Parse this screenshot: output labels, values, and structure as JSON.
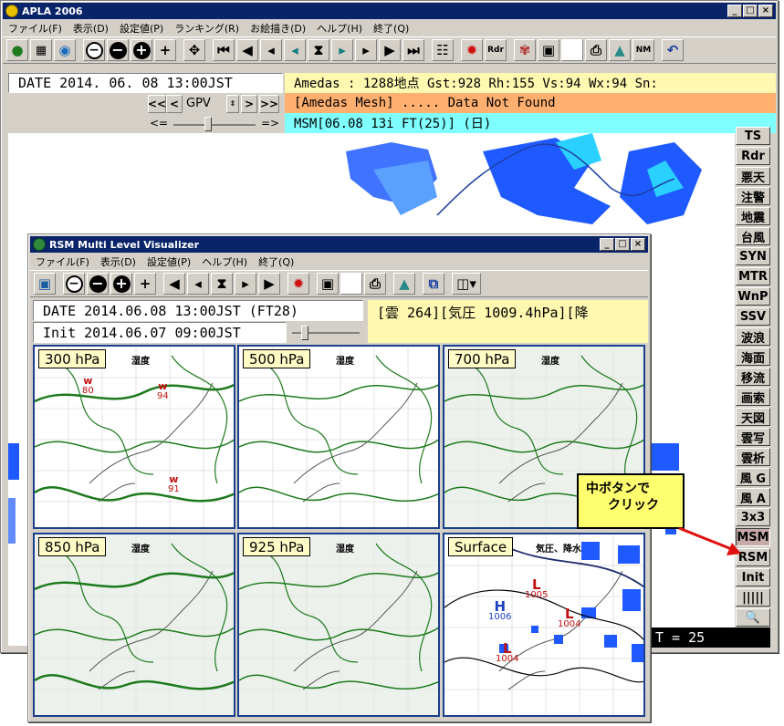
{
  "main_window": {
    "title": "APLA 2006",
    "menu": [
      "ファイル(F)",
      "表示(D)",
      "設定値(P)",
      "ランキング(R)",
      "お絵描き(D)",
      "ヘルプ(H)",
      "終了(Q)"
    ],
    "date": "DATE 2014. 06. 08  13:00JST",
    "gpv_label": "GPV",
    "nav": {
      "prev2": "<<",
      "prev": "<",
      "next": ">",
      "next2": ">>",
      "slider_left": "<=",
      "slider_right": "=>"
    },
    "amedas_line": "Amedas : 1288地点  Gst:928 Rh:155 Vs:94 Wx:94 Sn:",
    "mesh_line": "[Amedas Mesh] ..... Data Not Found",
    "msm_line": "MSM[06.08 13i FT(25)] (日)",
    "bottom_status": "T = 25",
    "side_buttons": [
      "TS",
      "Rdr",
      "悪天",
      "注警",
      "地震",
      "台風",
      "SYN",
      "MTR",
      "WnP",
      "SSV",
      "波浪",
      "海面",
      "移流",
      "画索",
      "天図",
      "雲写",
      "雲析",
      "風 G",
      "風 A",
      "3x3",
      "MSM",
      "RSM",
      "Init",
      "|||||",
      "🔍"
    ],
    "toolbar_text_buttons": {
      "rdr": "Rdr",
      "nm": "NM"
    }
  },
  "rsm_window": {
    "title": "RSM Multi Level Visualizer",
    "menu": [
      "ファイル(F)",
      "表示(D)",
      "設定値(P)",
      "ヘルプ(H)",
      "終了(Q)"
    ],
    "date": "DATE 2014.06.08 13:00JST (FT28)",
    "init": "Init 2014.06.07 09:00JST",
    "info": "[雲 264][気圧 1009.4hPa][降",
    "panels": [
      {
        "label": "300 hPa",
        "sub": "湿度",
        "marks": [
          {
            "t": "w",
            "v": "80"
          },
          {
            "t": "w",
            "v": "94"
          },
          {
            "t": "w",
            "v": "91"
          }
        ]
      },
      {
        "label": "500 hPa",
        "sub": "湿度"
      },
      {
        "label": "700 hPa",
        "sub": "湿度"
      },
      {
        "label": "850 hPa",
        "sub": "湿度"
      },
      {
        "label": "925 hPa",
        "sub": "湿度"
      },
      {
        "label": "Surface",
        "sub": "気圧、降水",
        "marks": [
          {
            "t": "L",
            "v": "1005"
          },
          {
            "t": "H",
            "v": "1006"
          },
          {
            "t": "L",
            "v": "1004"
          },
          {
            "t": "L",
            "v": "1004"
          }
        ]
      }
    ]
  },
  "callout": {
    "line1": "中ボタンで",
    "line2": "クリック"
  },
  "colors": {
    "title_bar": "#0a246a",
    "amedas_band": "#fff8b0",
    "mesh_band": "#ffb070",
    "msm_band": "#7fffff",
    "contour": "#1e7a1e",
    "rain": "#1e5aff"
  }
}
